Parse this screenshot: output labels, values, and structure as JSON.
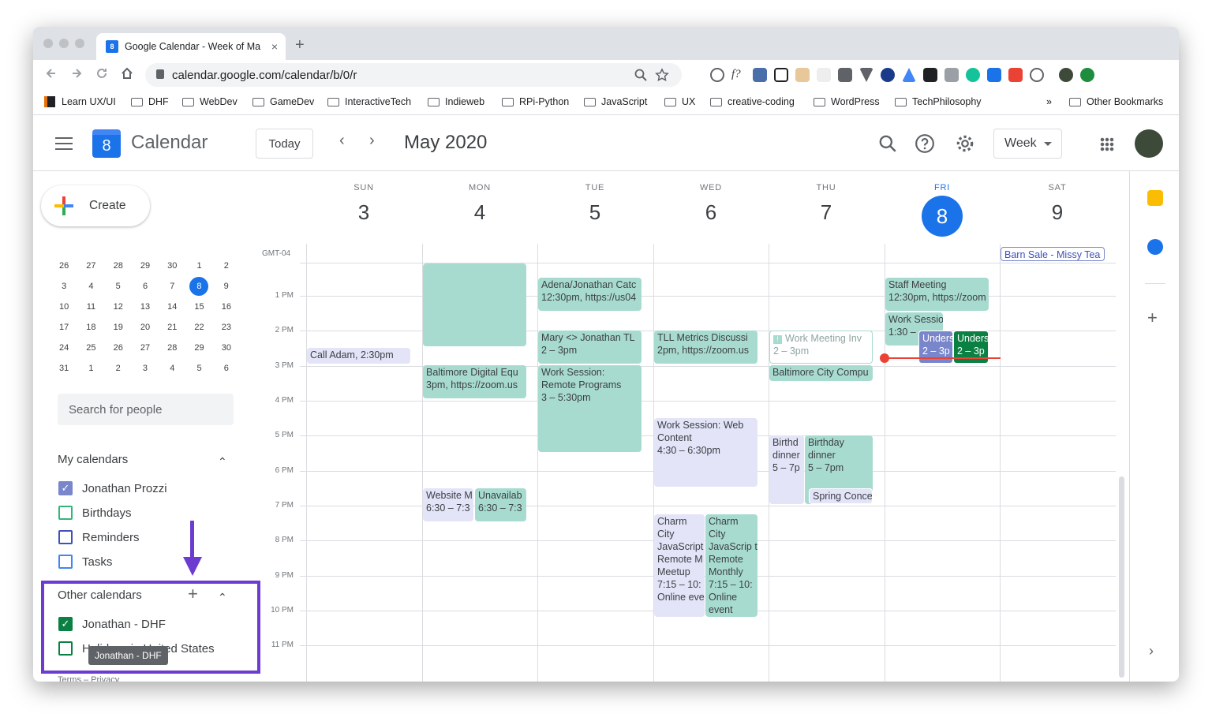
{
  "browser": {
    "tab_title": "Google Calendar - Week of Ma",
    "tab_favicon": "8",
    "close_glyph": "×",
    "newtab_glyph": "+",
    "url": "calendar.google.com/calendar/b/0/r",
    "bookmarks": [
      "Learn UX/UI",
      "DHF",
      "WebDev",
      "GameDev",
      "InteractiveTech",
      "Indieweb",
      "RPi-Python",
      "JavaScript",
      "UX",
      "creative-coding",
      "WordPress",
      "TechPhilosophy"
    ],
    "more_glyph": "»",
    "other_bookmarks": "Other Bookmarks",
    "extension_f": "f?"
  },
  "header": {
    "logo_digit": "8",
    "app_title": "Calendar",
    "today_label": "Today",
    "prev_glyph": "‹",
    "next_glyph": "›",
    "month_label": "May 2020",
    "view_label": "Week"
  },
  "sidebar": {
    "create_label": "Create",
    "mini_calendar": [
      [
        "26",
        "27",
        "28",
        "29",
        "30",
        "1",
        "2"
      ],
      [
        "3",
        "4",
        "5",
        "6",
        "7",
        "8",
        "9"
      ],
      [
        "10",
        "11",
        "12",
        "13",
        "14",
        "15",
        "16"
      ],
      [
        "17",
        "18",
        "19",
        "20",
        "21",
        "22",
        "23"
      ],
      [
        "24",
        "25",
        "26",
        "27",
        "28",
        "29",
        "30"
      ],
      [
        "31",
        "1",
        "2",
        "3",
        "4",
        "5",
        "6"
      ]
    ],
    "search_placeholder": "Search for people",
    "my_calendars_title": "My calendars",
    "my_calendars": [
      {
        "label": "Jonathan Prozzi",
        "checked": true,
        "color": "#7986cb"
      },
      {
        "label": "Birthdays",
        "checked": false,
        "color": "#33b679"
      },
      {
        "label": "Reminders",
        "checked": false,
        "color": "#3f51b5"
      },
      {
        "label": "Tasks",
        "checked": false,
        "color": "#4285f4"
      }
    ],
    "other_calendars_title": "Other calendars",
    "other_calendars": [
      {
        "label": "Jonathan - DHF",
        "checked": true,
        "color": "#0b8043"
      },
      {
        "label": "Holidays in United States",
        "checked": false,
        "color": "#0b8043"
      }
    ],
    "tooltip": "Jonathan - DHF",
    "terms": "Terms – Privacy",
    "add_glyph": "+",
    "caret_glyph": "⌃",
    "check_glyph": "✓"
  },
  "week": {
    "days": [
      {
        "name": "SUN",
        "date": "3"
      },
      {
        "name": "MON",
        "date": "4"
      },
      {
        "name": "TUE",
        "date": "5"
      },
      {
        "name": "WED",
        "date": "6"
      },
      {
        "name": "THU",
        "date": "7"
      },
      {
        "name": "FRI",
        "date": "8"
      },
      {
        "name": "SAT",
        "date": "9"
      }
    ],
    "timezone": "GMT-04",
    "hours": [
      "1 PM",
      "2 PM",
      "3 PM",
      "4 PM",
      "5 PM",
      "6 PM",
      "7 PM",
      "8 PM",
      "9 PM",
      "10 PM",
      "11 PM"
    ]
  },
  "events": {
    "barn_sale": "Barn Sale - Missy Tea",
    "call_adam": "Call Adam,",
    "call_adam_time": "2:30pm",
    "adena_title": "Adena/Jonathan Catc",
    "adena_time": "12:30pm, https://us04",
    "mary_title": "Mary <> Jonathan TL",
    "mary_time": "2 – 3pm",
    "work_remote_title": "Work Session: Remote Programs",
    "work_remote_time": "3 – 5:30pm",
    "baltimore_digital_title": "Baltimore Digital Equ",
    "baltimore_digital_time": "3pm, https://zoom.us",
    "website_title": "Website M",
    "website_time": "6:30 – 7:3",
    "unavailable_title": "Unavailab",
    "unavailable_time": "6:30 – 7:3",
    "tll_title": "TLL Metrics Discussi",
    "tll_time": "2pm, https://zoom.us",
    "web_content_title": "Work Session: Web Content",
    "web_content_time": "4:30 – 6:30pm",
    "charm1_title": "Charm City JavaScript Remote M Meetup",
    "charm1_time": "7:15 – 10:",
    "charm1_note": "Online eve",
    "charm2_title": "Charm City JavaScrip t Remote Monthly",
    "charm2_time": "7:15 – 10:",
    "charm2_note": "Online event",
    "work_meeting_title": "Work Meeting Inv",
    "work_meeting_time": "2 – 3pm",
    "alert_glyph": "!",
    "baltimore_city_title": "Baltimore City Compu",
    "birthday1_title": "Birthd dinner",
    "birthday1_time": "5 – 7p",
    "birthday2_title": "Birthday dinner",
    "birthday2_time": "5 – 7pm",
    "spring_title": "Spring Conce",
    "staff_title": "Staff Meeting",
    "staff_time": "12:30pm, https://zoom",
    "work_session_fri_title": "Work Sessio",
    "work_session_fri_time": "1:30 –",
    "under1_title": "Unders",
    "under1_time": "2 – 3p",
    "under2_title": "Unders",
    "under2_time": "2 – 3p"
  },
  "colors": {
    "accent": "#1a73e8",
    "event_teal": "#a8dbd0",
    "now_line": "#ea4335",
    "highlight_box": "#6c3bcf"
  }
}
